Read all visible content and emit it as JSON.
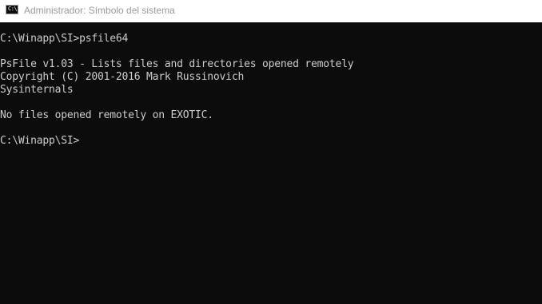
{
  "window": {
    "title": "Administrador: Símbolo del sistema",
    "icon": "cmd-icon",
    "icon_text": "C:\\"
  },
  "console": {
    "lines": [
      "C:\\Winapp\\SI>psfile64",
      "",
      "PsFile v1.03 - Lists files and directories opened remotely",
      "Copyright (C) 2001-2016 Mark Russinovich",
      "Sysinternals",
      "",
      "No files opened remotely on EXOTIC.",
      "",
      "C:\\Winapp\\SI>"
    ]
  },
  "colors": {
    "background": "#0c0c0c",
    "text": "#cccccc",
    "titlebar": "#ffffff",
    "title_text": "#9a9a9a"
  }
}
